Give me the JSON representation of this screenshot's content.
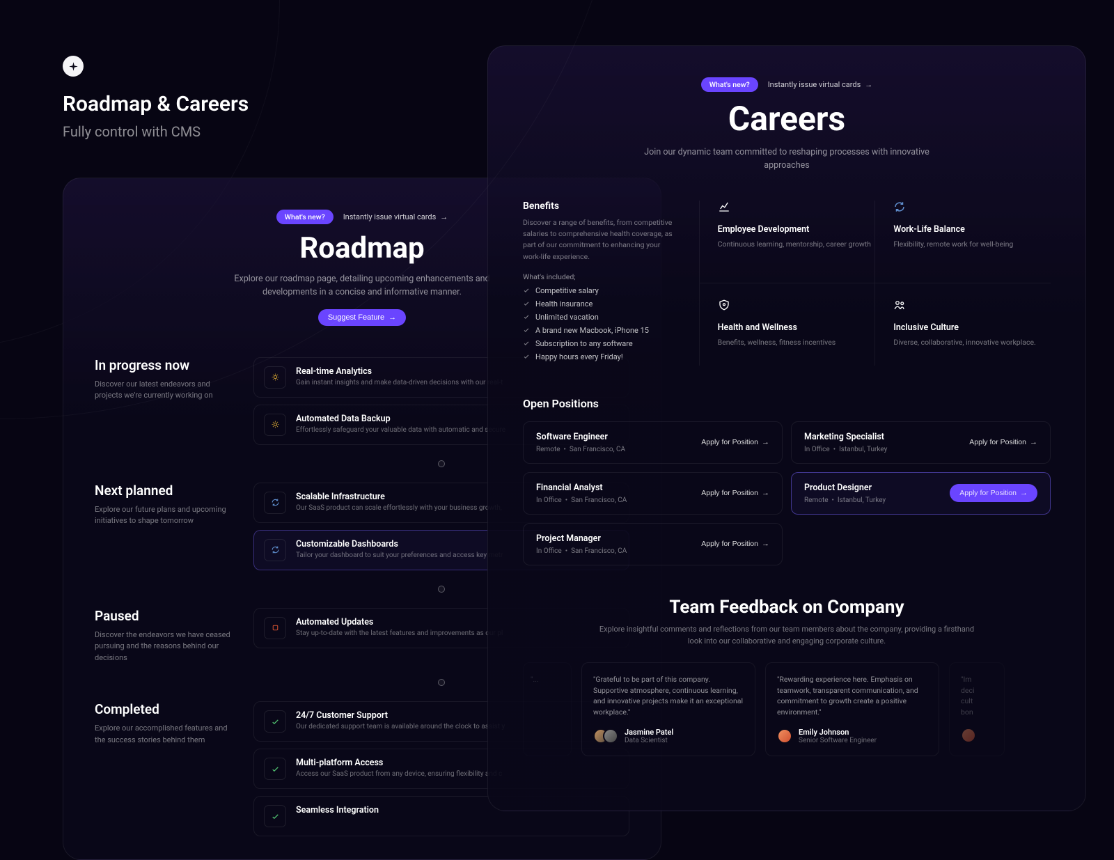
{
  "header": {
    "title": "Roadmap & Careers",
    "subtitle": "Fully control with CMS"
  },
  "badge": {
    "label": "What's new?",
    "link": "Instantly issue virtual cards"
  },
  "roadmap": {
    "title": "Roadmap",
    "subtitle": "Explore our roadmap page, detailing upcoming enhancements and developments in a concise and informative manner.",
    "cta": "Suggest Feature",
    "sections": [
      {
        "title": "In progress now",
        "desc": "Discover our latest endeavors and projects we're currently working on",
        "items": [
          {
            "title": "Real-time Analytics",
            "desc": "Gain instant insights and make data-driven decisions with our real-t",
            "icon": "sun"
          },
          {
            "title": "Automated Data Backup",
            "desc": "Effortlessly safeguard your valuable data with automatic and secure",
            "icon": "sun"
          }
        ]
      },
      {
        "title": "Next planned",
        "desc": "Explore our future plans and upcoming initiatives to shape tomorrow",
        "items": [
          {
            "title": "Scalable Infrastructure",
            "desc": "Our SaaS product can scale effortlessly with your business growth,",
            "icon": "refresh"
          },
          {
            "title": "Customizable Dashboards",
            "desc": "Tailor your dashboard to suit your preferences and access key metr",
            "icon": "refresh",
            "highlight": true
          }
        ]
      },
      {
        "title": "Paused",
        "desc": "Discover the endeavors we have ceased pursuing and the reasons behind our decisions",
        "items": [
          {
            "title": "Automated Updates",
            "desc": "Stay up-to-date with the latest features and improvements as our pl",
            "icon": "square"
          }
        ]
      },
      {
        "title": "Completed",
        "desc": "Explore our accomplished features and the success stories behind them",
        "items": [
          {
            "title": "24/7 Customer Support",
            "desc": "Our dedicated support team is available around the clock to assist y",
            "icon": "check"
          },
          {
            "title": "Multi-platform Access",
            "desc": "Access our SaaS product from any device, ensuring flexibility and c",
            "icon": "check"
          },
          {
            "title": "Seamless Integration",
            "desc": "",
            "icon": "check"
          }
        ]
      }
    ]
  },
  "careers": {
    "title": "Careers",
    "subtitle": "Join our dynamic team committed to reshaping processes with innovative approaches",
    "benefits_title": "Benefits",
    "benefits_desc": "Discover a range of benefits, from competitive salaries to comprehensive health coverage, as part of our commitment to enhancing your work-life experience.",
    "included_label": "What's included;",
    "included": [
      "Competitive salary",
      "Health insurance",
      "Unlimited vacation",
      "A brand new Macbook, iPhone 15",
      "Subscription to any software",
      "Happy hours every Friday!"
    ],
    "cells": [
      {
        "title": "Employee Development",
        "desc": "Continuous learning, mentorship, career growth",
        "icon": "chart"
      },
      {
        "title": "Work-Life Balance",
        "desc": "Flexibility, remote work for well-being",
        "icon": "refresh"
      },
      {
        "title": "Health and Wellness",
        "desc": "Benefits, wellness, fitness incentives",
        "icon": "shield"
      },
      {
        "title": "Inclusive Culture",
        "desc": "Diverse, collaborative, innovative workplace.",
        "icon": "people"
      }
    ],
    "positions_title": "Open Positions",
    "apply_label": "Apply for Position",
    "positions": [
      {
        "title": "Software Engineer",
        "mode": "Remote",
        "loc": "San Francisco, CA"
      },
      {
        "title": "Marketing Specialist",
        "mode": "In Office",
        "loc": "Istanbul, Turkey"
      },
      {
        "title": "Financial Analyst",
        "mode": "In Office",
        "loc": "San Francisco, CA"
      },
      {
        "title": "Product Designer",
        "mode": "Remote",
        "loc": "Istanbul, Turkey",
        "highlight": true
      },
      {
        "title": "Project Manager",
        "mode": "In Office",
        "loc": "San Francisco, CA"
      }
    ],
    "feedback_title": "Team Feedback on Company",
    "feedback_sub": "Explore insightful comments and reflections from our team members about the company, providing a firsthand look into our collaborative and engaging corporate culture.",
    "testimonials": [
      {
        "text": "\"Grateful to be part of this company. Supportive atmosphere, continuous learning, and innovative projects make it an exceptional workplace.\"",
        "name": "Jasmine Patel",
        "role": "Data Scientist"
      },
      {
        "text": "\"Rewarding experience here. Emphasis on teamwork, transparent communication, and commitment to growth create a positive environment.\"",
        "name": "Emily Johnson",
        "role": "Senior Software Engineer"
      }
    ]
  }
}
